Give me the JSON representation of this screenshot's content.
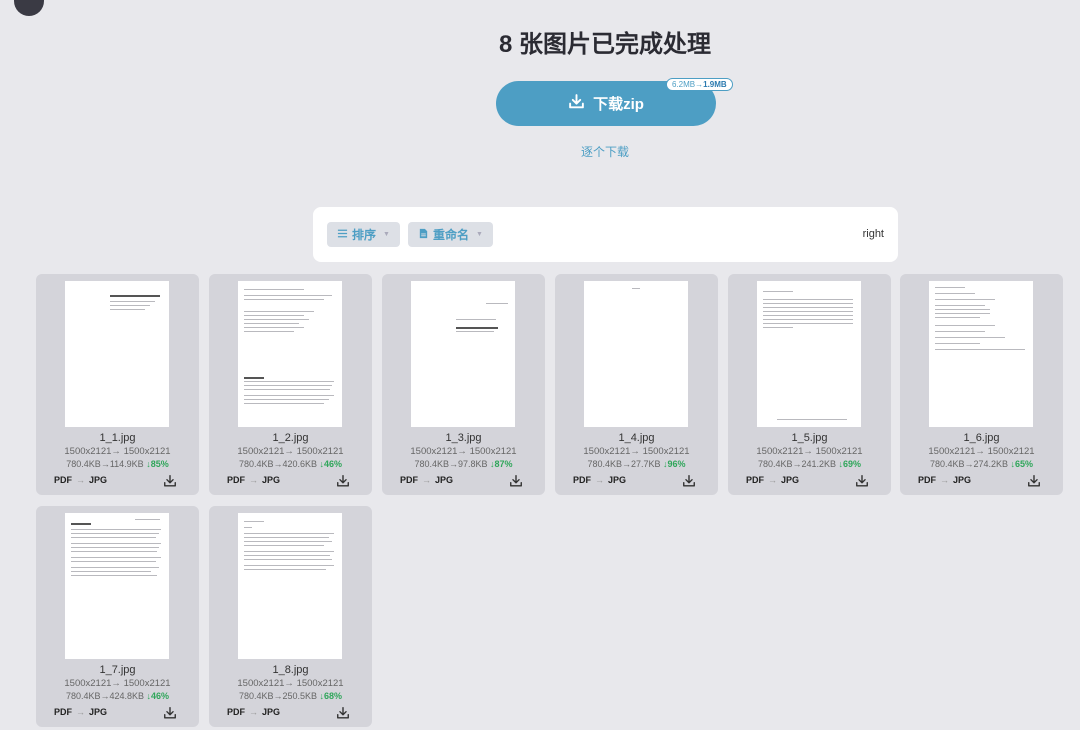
{
  "header": {
    "title": "8 张图片已完成处理",
    "zip_label": "下载zip",
    "size_from": "6.2MB",
    "size_to": "1.9MB",
    "each_label": "逐个下载"
  },
  "toolbar": {
    "sort_label": "排序",
    "rename_label": "重命名",
    "right_text": "right"
  },
  "files": [
    {
      "name": "1_1.jpg",
      "dim_from": "1500x2121",
      "dim_to": "1500x2121",
      "size_from": "780.4KB",
      "size_to": "114.9KB",
      "saving": "85%",
      "fmt_from": "PDF",
      "fmt_to": "JPG"
    },
    {
      "name": "1_2.jpg",
      "dim_from": "1500x2121",
      "dim_to": "1500x2121",
      "size_from": "780.4KB",
      "size_to": "420.6KB",
      "saving": "46%",
      "fmt_from": "PDF",
      "fmt_to": "JPG"
    },
    {
      "name": "1_3.jpg",
      "dim_from": "1500x2121",
      "dim_to": "1500x2121",
      "size_from": "780.4KB",
      "size_to": "97.8KB",
      "saving": "87%",
      "fmt_from": "PDF",
      "fmt_to": "JPG"
    },
    {
      "name": "1_4.jpg",
      "dim_from": "1500x2121",
      "dim_to": "1500x2121",
      "size_from": "780.4KB",
      "size_to": "27.7KB",
      "saving": "96%",
      "fmt_from": "PDF",
      "fmt_to": "JPG"
    },
    {
      "name": "1_5.jpg",
      "dim_from": "1500x2121",
      "dim_to": "1500x2121",
      "size_from": "780.4KB",
      "size_to": "241.2KB",
      "saving": "69%",
      "fmt_from": "PDF",
      "fmt_to": "JPG"
    },
    {
      "name": "1_6.jpg",
      "dim_from": "1500x2121",
      "dim_to": "1500x2121",
      "size_from": "780.4KB",
      "size_to": "274.2KB",
      "saving": "65%",
      "fmt_from": "PDF",
      "fmt_to": "JPG"
    },
    {
      "name": "1_7.jpg",
      "dim_from": "1500x2121",
      "dim_to": "1500x2121",
      "size_from": "780.4KB",
      "size_to": "424.8KB",
      "saving": "46%",
      "fmt_from": "PDF",
      "fmt_to": "JPG"
    },
    {
      "name": "1_8.jpg",
      "dim_from": "1500x2121",
      "dim_to": "1500x2121",
      "size_from": "780.4KB",
      "size_to": "250.5KB",
      "saving": "68%",
      "fmt_from": "PDF",
      "fmt_to": "JPG"
    }
  ],
  "colors": {
    "accent": "#4d9ec4",
    "saving": "#2fa65a",
    "background": "#e8e8ec",
    "card": "#d4d4da"
  },
  "icons": {
    "zip": "download-icon",
    "sort": "list-icon",
    "rename": "file-icon",
    "file_download": "download-icon"
  }
}
